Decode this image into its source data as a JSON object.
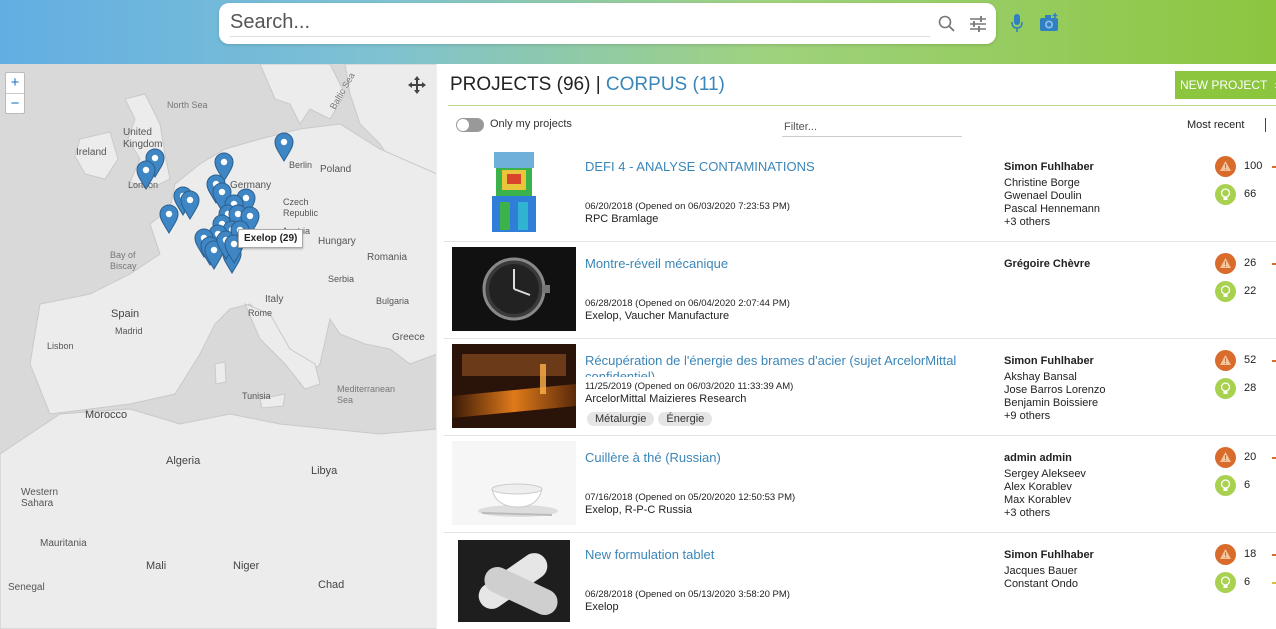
{
  "search": {
    "placeholder": "Search..."
  },
  "header": {
    "colors": {
      "gradient_start": "#62aee3",
      "gradient_end": "#8cc63f"
    },
    "icons": [
      "search-icon",
      "filter-sliders-icon",
      "microphone-icon",
      "camera-icon"
    ]
  },
  "map": {
    "zoom_in": "+",
    "zoom_out": "−",
    "tooltip": "Exelop (29)",
    "labels": {
      "north_sea": "North Sea",
      "baltic_sea": "Baltic Sea",
      "united_kingdom": "United Kingdom",
      "ireland": "Ireland",
      "london": "London",
      "berlin": "Berlin",
      "poland": "Poland",
      "germany": "Germany",
      "czech": "Czech Republic",
      "austria": "Austria",
      "hungary": "Hungary",
      "romania": "Romania",
      "bay_of_biscay": "Bay of Biscay",
      "spain": "Spain",
      "italy": "Italy",
      "rome": "Rome",
      "lisbon": "Lisbon",
      "madrid": "Madrid",
      "algeria": "Algeria",
      "morocco": "Morocco",
      "tunisia": "Tunisia",
      "libya": "Libya",
      "mali": "Mali",
      "niger": "Niger",
      "chad": "Chad",
      "senegal": "Senegal",
      "western_sahara": "Western Sahara",
      "mauritania": "Mauritania",
      "mediterranean": "Mediterranean Sea",
      "serbia": "Serbia",
      "greece": "Greece",
      "bulgaria": "Bulgaria"
    }
  },
  "page": {
    "projects_label": "PROJECTS (96)",
    "separator": "|",
    "corpus_label": "CORPUS (11)",
    "new_project": "NEW PROJECT",
    "new_project_chevron": "›",
    "only_my_projects": "Only my projects",
    "filter_placeholder": "Filter...",
    "sort_label": "Most recent",
    "accent": "#8cc63f",
    "link_color": "#3b86b8"
  },
  "projects": [
    {
      "title": "DEFI 4 - ANALYSE CONTAMINATIONS",
      "date": "06/20/2018 (Opened on 06/03/2020 7:23:53 PM)",
      "org": "RPC Bramlage",
      "lead": "Simon Fuhlhaber",
      "members": [
        "Christine Borge",
        "Gwenael Doulin",
        "Pascal Hennemann",
        "+3 others"
      ],
      "problems": "100",
      "ideas": "66",
      "tags": []
    },
    {
      "title": "Montre-réveil mécanique",
      "date": "06/28/2018 (Opened on 06/04/2020 2:07:44 PM)",
      "org": "Exelop, Vaucher Manufacture",
      "lead": "Grégoire Chèvre",
      "members": [],
      "problems": "26",
      "ideas": "22",
      "tags": []
    },
    {
      "title": "Récupération de l'énergie des brames d'acier (sujet ArcelorMittal confidentiel)",
      "date": "11/25/2019 (Opened on 06/03/2020 11:33:39 AM)",
      "org": "ArcelorMittal Maizieres Research",
      "lead": "Simon Fuhlhaber",
      "members": [
        "Akshay Bansal",
        "Jose Barros Lorenzo",
        "Benjamin Boissiere",
        "+9 others"
      ],
      "problems": "52",
      "ideas": "28",
      "tags": [
        "Métalurgie",
        "Énergie"
      ]
    },
    {
      "title": "Cuillère à thé (Russian)",
      "date": "07/16/2018 (Opened on 05/20/2020 12:50:53 PM)",
      "org": "Exelop, R-P-C Russia",
      "lead": "admin admin",
      "members": [
        "Sergey Alekseev",
        "Alex Korablev",
        "Max Korablev",
        "+3 others"
      ],
      "problems": "20",
      "ideas": "6",
      "tags": []
    },
    {
      "title": "New formulation tablet",
      "date": "06/28/2018 (Opened on 05/13/2020 3:58:20 PM)",
      "org": "Exelop",
      "lead": "Simon Fuhlhaber",
      "members": [
        "Jacques Bauer",
        "Constant Ondo"
      ],
      "problems": "18",
      "ideas": "6",
      "tags": []
    }
  ]
}
